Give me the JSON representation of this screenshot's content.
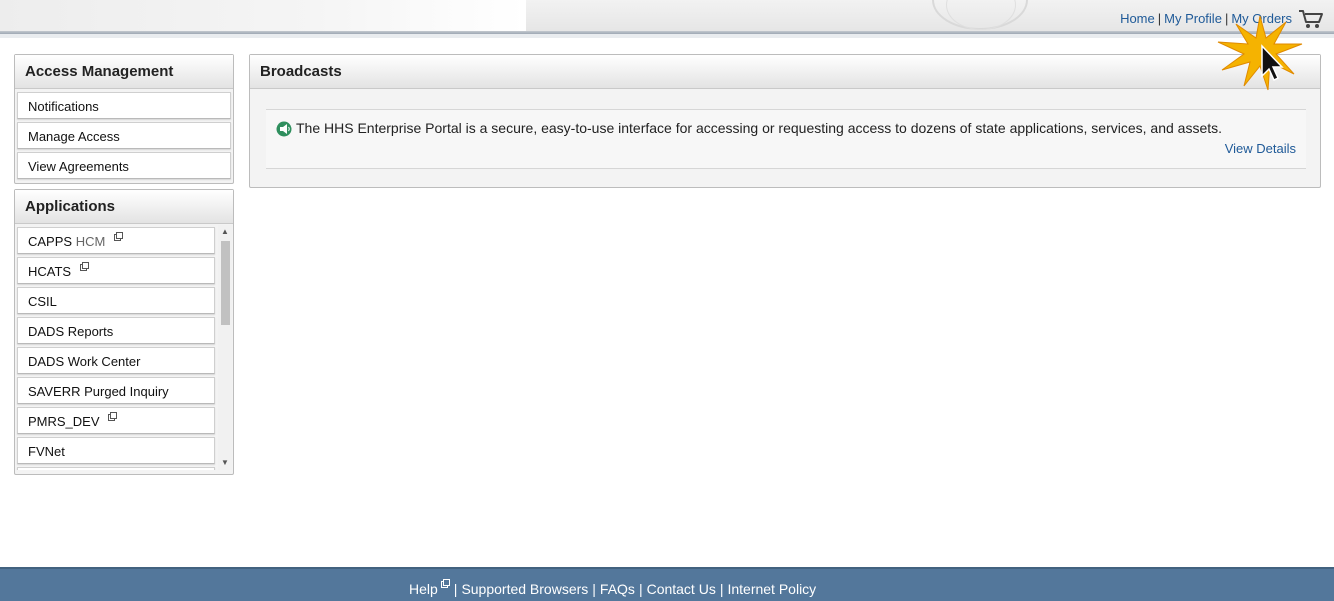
{
  "header": {
    "nav": {
      "home": "Home",
      "profile": "My Profile",
      "orders": "My Orders",
      "separator": "|"
    },
    "cart_icon": "shopping-cart-icon"
  },
  "access_management": {
    "title": "Access Management",
    "items": [
      "Notifications",
      "Manage Access",
      "View Agreements"
    ]
  },
  "applications": {
    "title": "Applications",
    "items": [
      {
        "label": "CAPPS",
        "suffix": "HCM",
        "external": true
      },
      {
        "label": "HCATS",
        "suffix": "",
        "external": true
      },
      {
        "label": "CSIL",
        "suffix": "",
        "external": false
      },
      {
        "label": "DADS Reports",
        "suffix": "",
        "external": false
      },
      {
        "label": "DADS Work Center",
        "suffix": "",
        "external": false
      },
      {
        "label": "SAVERR Purged Inquiry",
        "suffix": "",
        "external": false
      },
      {
        "label": "PMRS_DEV",
        "suffix": "",
        "external": true
      },
      {
        "label": "FVNet",
        "suffix": "",
        "external": false
      }
    ]
  },
  "broadcasts": {
    "title": "Broadcasts",
    "message": "The HHS Enterprise Portal is a secure, easy-to-use interface for accessing or requesting access to dozens of state applications, services, and assets.",
    "link": "View Details",
    "icon": "broadcast-icon"
  },
  "footer": {
    "links": [
      "Help",
      "Supported Browsers",
      "FAQs",
      "Contact Us",
      "Internet Policy"
    ],
    "separator": "|"
  },
  "colors": {
    "link": "#1f5a98",
    "footer_bg": "#53779b",
    "cursor_highlight": "#f5b301"
  }
}
